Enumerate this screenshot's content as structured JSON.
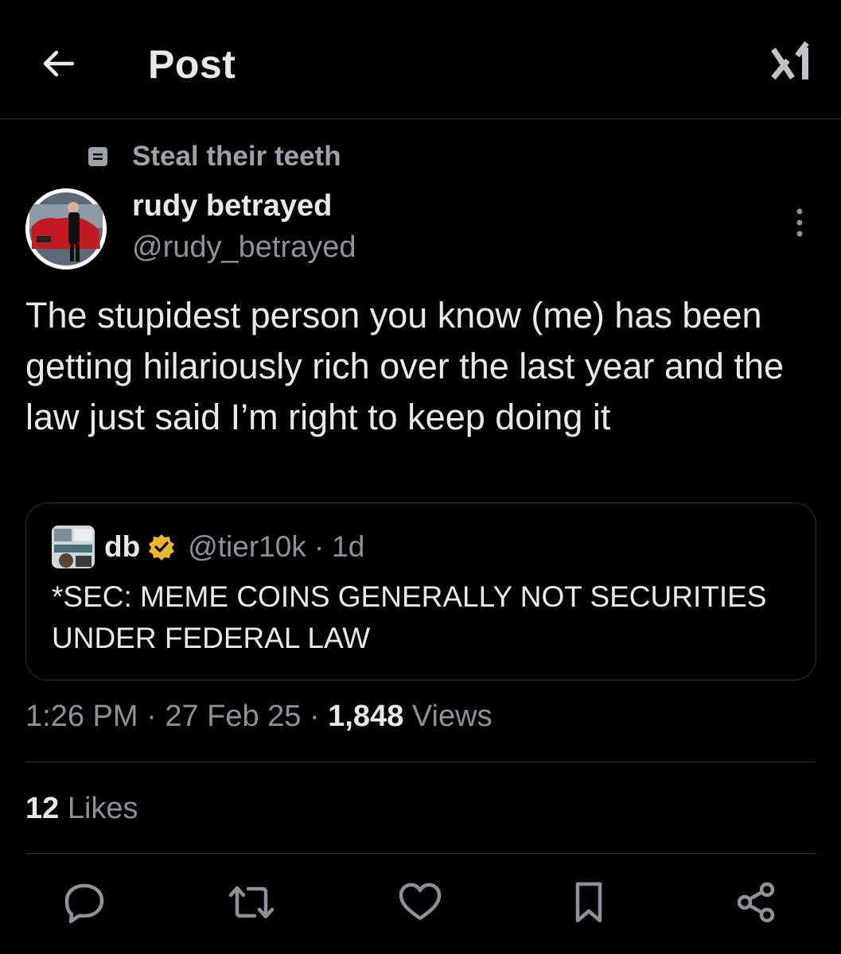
{
  "header": {
    "back_icon": "arrow-left-icon",
    "title": "Post",
    "logo_icon": "x-logo-icon"
  },
  "community": {
    "icon": "community-icon",
    "label": "Steal their teeth"
  },
  "post": {
    "author_name": "rudy betrayed",
    "author_handle": "@rudy_betrayed",
    "text": "The stupidest person you know (me) has been getting hilariously rich over the last year and the law just said I’m right to keep doing it",
    "more_icon": "more-vertical-icon"
  },
  "quote": {
    "author_name": "db",
    "verified": true,
    "handle": "@tier10k",
    "separator": "·",
    "age": "1d",
    "text": "*SEC: MEME COINS GENERALLY NOT SECURITIES UNDER FEDERAL LAW"
  },
  "meta": {
    "time": "1:26 PM",
    "sep1": "·",
    "date": "27 Feb 25",
    "sep2": "·",
    "views_count": "1,848",
    "views_label": "Views"
  },
  "engagement": {
    "likes_count": "12",
    "likes_label": "Likes"
  },
  "actions": [
    "reply-icon",
    "repost-icon",
    "like-icon",
    "bookmark-icon",
    "share-icon"
  ],
  "colors": {
    "background": "#000000",
    "primary_text": "#e7e9ea",
    "secondary_text": "#8b9399",
    "divider": "#2f3336",
    "verified_gold": "#e8b829"
  }
}
